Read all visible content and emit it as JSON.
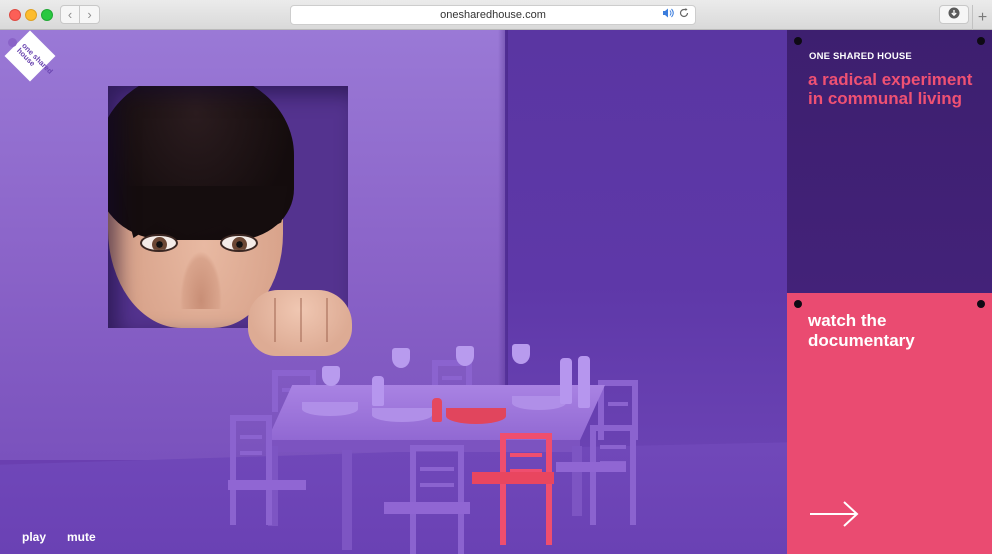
{
  "browser": {
    "url": "onesharedhouse.com"
  },
  "logo": {
    "text": "one shared house"
  },
  "controls": {
    "play_label": "play",
    "mute_label": "mute"
  },
  "sidebar": {
    "brand": "ONE SHARED HOUSE",
    "tagline": "a radical experiment in communal living",
    "cta_label": "watch the documentary"
  },
  "colors": {
    "accent_pink": "#ea4b71",
    "panel_purple": "#3d1f6f",
    "scene_purple": "#8a63c8"
  },
  "icons": [
    "speaker-icon",
    "reload-icon",
    "download-icon",
    "arrow-right-icon"
  ]
}
